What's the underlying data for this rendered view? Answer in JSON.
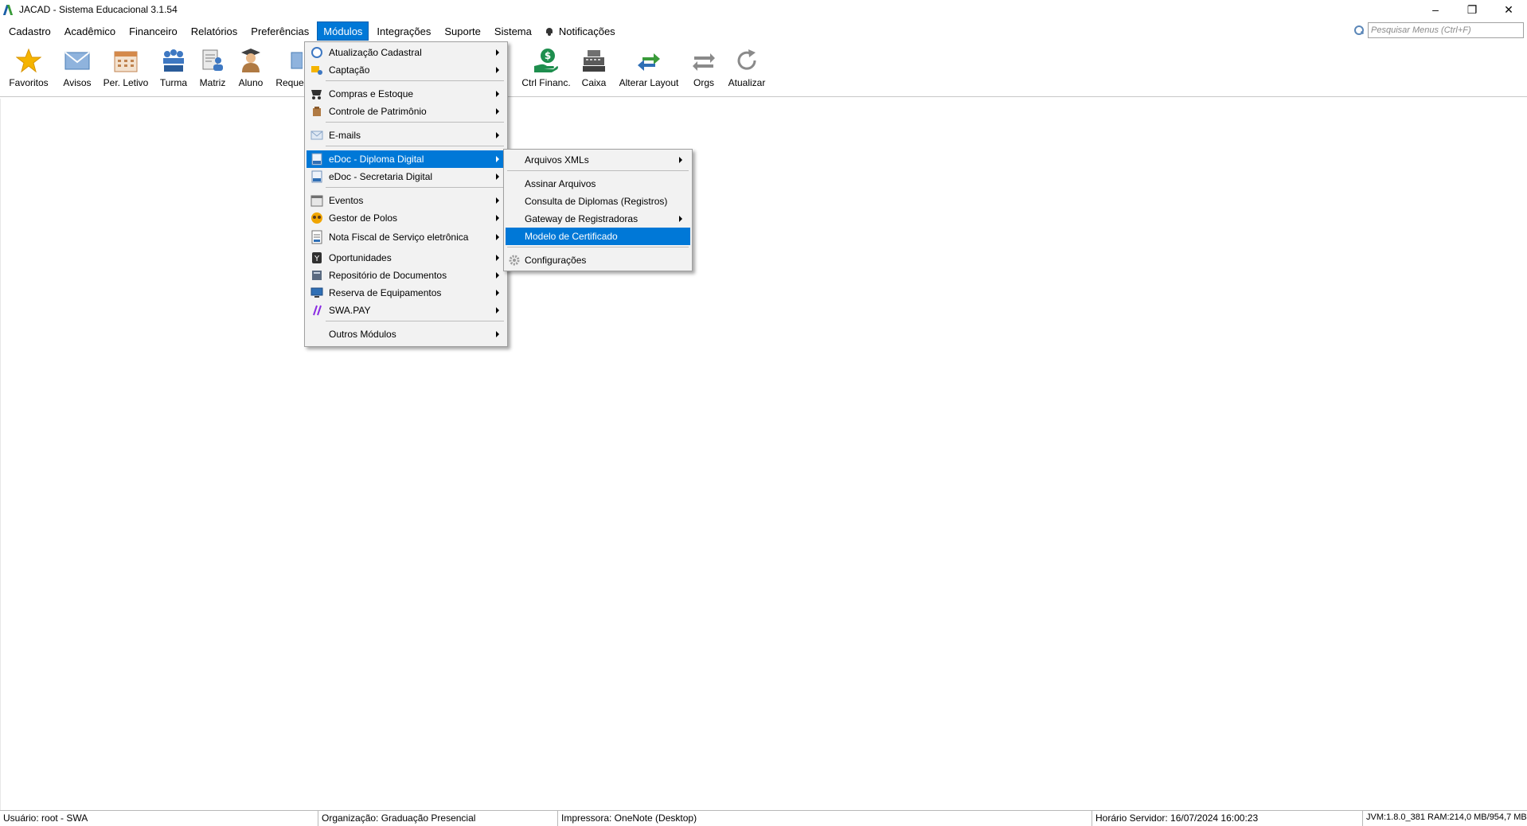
{
  "window": {
    "title": "JACAD - Sistema Educacional 3.1.54",
    "controls": {
      "minimize": "–",
      "restore": "❐",
      "close": "✕"
    }
  },
  "menubar": {
    "items": [
      {
        "label": "Cadastro"
      },
      {
        "label": "Acadêmico"
      },
      {
        "label": "Financeiro"
      },
      {
        "label": "Relatórios"
      },
      {
        "label": "Preferências"
      },
      {
        "label": "Módulos"
      },
      {
        "label": "Integrações"
      },
      {
        "label": "Suporte"
      },
      {
        "label": "Sistema"
      }
    ],
    "notifications": "Notificações",
    "search_placeholder": "Pesquisar Menus (Ctrl+F)"
  },
  "toolbar": {
    "items": [
      {
        "label": "Favoritos",
        "icon": "star-icon"
      },
      {
        "label": "Avisos",
        "icon": "envelope-icon"
      },
      {
        "label": "Per. Letivo",
        "icon": "calendar-icon"
      },
      {
        "label": "Turma",
        "icon": "group-icon"
      },
      {
        "label": "Matriz",
        "icon": "document-person-icon"
      },
      {
        "label": "Aluno",
        "icon": "student-icon"
      },
      {
        "label": "Reque",
        "icon": "request-icon"
      },
      {
        "label": "Ctrl Financ.",
        "icon": "money-hand-icon"
      },
      {
        "label": "Caixa",
        "icon": "cash-register-icon"
      },
      {
        "label": "Alterar Layout",
        "icon": "swap-arrows-icon"
      },
      {
        "label": "Orgs",
        "icon": "transfer-arrows-icon"
      },
      {
        "label": "Atualizar",
        "icon": "refresh-icon"
      }
    ]
  },
  "modules_menu": {
    "items": [
      {
        "label": "Atualização Cadastral",
        "icon": "atualizacao-icon"
      },
      {
        "label": "Captação",
        "icon": "captacao-icon"
      },
      {
        "label": "Compras e Estoque",
        "icon": "compras-icon"
      },
      {
        "label": "Controle de Patrimônio",
        "icon": "patrimonio-icon"
      },
      {
        "label": "E-mails",
        "icon": "email-icon"
      },
      {
        "label": "eDoc - Diploma Digital",
        "icon": "edoc-diploma-icon"
      },
      {
        "label": "eDoc - Secretaria Digital",
        "icon": "edoc-secretaria-icon"
      },
      {
        "label": "Eventos",
        "icon": "eventos-icon"
      },
      {
        "label": "Gestor de Polos",
        "icon": "gestor-polos-icon"
      },
      {
        "label": "Nota Fiscal de Serviço eletrônica",
        "icon": "nota-fiscal-icon"
      },
      {
        "label": "Oportunidades",
        "icon": "oportunidades-icon"
      },
      {
        "label": "Repositório de Documentos",
        "icon": "repositorio-icon"
      },
      {
        "label": "Reserva de Equipamentos",
        "icon": "reserva-icon"
      },
      {
        "label": "SWA.PAY",
        "icon": "swapay-icon"
      },
      {
        "label": "Outros Módulos",
        "icon": ""
      }
    ]
  },
  "edoc_submenu": {
    "items": [
      {
        "label": "Arquivos XMLs"
      },
      {
        "label": "Assinar Arquivos"
      },
      {
        "label": "Consulta de Diplomas (Registros)"
      },
      {
        "label": "Gateway de Registradoras"
      },
      {
        "label": "Modelo de Certificado"
      },
      {
        "label": "Configurações",
        "icon": "gear-icon"
      }
    ]
  },
  "statusbar": {
    "user": "Usuário: root - SWA",
    "org": "Organização: Graduação Presencial",
    "printer": "Impressora: OneNote (Desktop)",
    "server_time": "Horário Servidor: 16/07/2024 16:00:23",
    "jvm": "JVM:1.8.0_381  RAM:214,0 MB/954,7 MB"
  },
  "colors": {
    "accent": "#0078d7",
    "menu_bg": "#f2f2f2"
  }
}
